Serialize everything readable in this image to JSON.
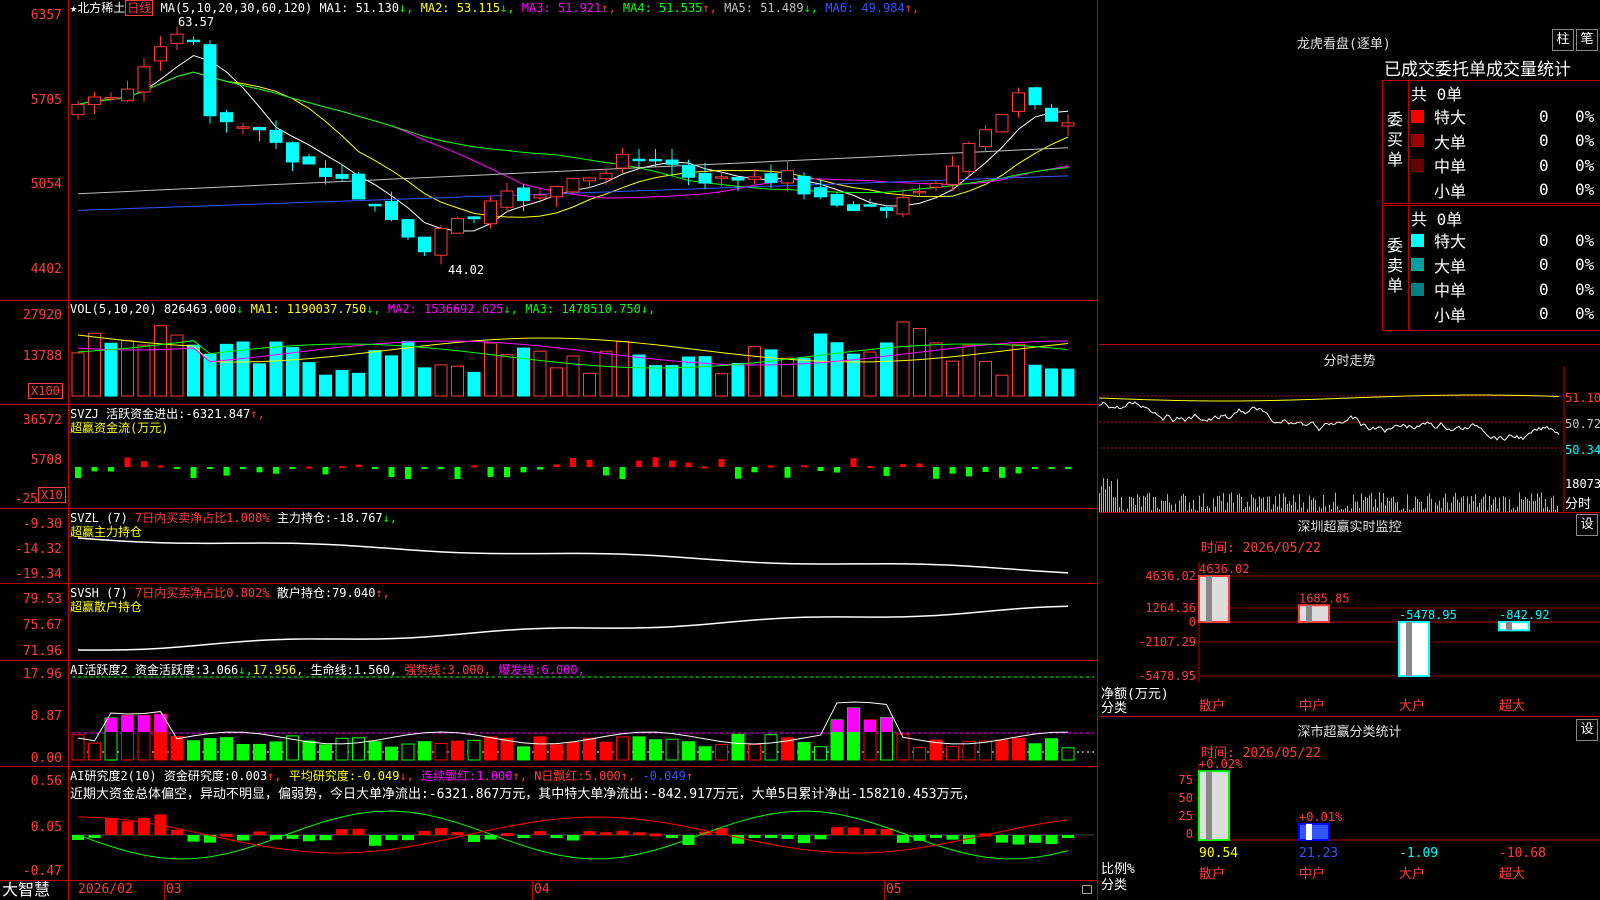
{
  "kline": {
    "star": "★",
    "stock_name": "北方稀土",
    "period": "日线",
    "ma_label": "MA(5,10,20,30,60,120)",
    "ma": [
      {
        "label": "MA1:",
        "value": "51.130",
        "arrow": "↓",
        "color": "#ffffff"
      },
      {
        "label": "MA2:",
        "value": "53.115",
        "arrow": "↓",
        "color": "#ffff00"
      },
      {
        "label": "MA3:",
        "value": "51.921",
        "arrow": "↑",
        "color": "#ff00ff"
      },
      {
        "label": "MA4:",
        "value": "51.535",
        "arrow": "↑",
        "color": "#00ff00"
      },
      {
        "label": "MA5:",
        "value": "51.489",
        "arrow": "↓",
        "color": "#c0c0c0"
      },
      {
        "label": "MA6:",
        "value": "49.984",
        "arrow": "↑",
        "color": "#3355ff"
      }
    ],
    "yaxis": [
      "6357",
      "5705",
      "5054",
      "4402"
    ],
    "high_mark": "63.57",
    "low_mark": "44.02"
  },
  "vol": {
    "label": "VOL(5,10,20)",
    "value": "826463.000",
    "value_arrow": "↓",
    "ma": [
      {
        "label": "MA1:",
        "value": "1190037.750",
        "arrow": "↓",
        "color": "#ffff00"
      },
      {
        "label": "MA2:",
        "value": "1536692.625",
        "arrow": "↓",
        "color": "#ff00ff"
      },
      {
        "label": "MA3:",
        "value": "1478510.750",
        "arrow": "↓",
        "color": "#00ff00"
      }
    ],
    "yaxis": [
      "27920",
      "13788"
    ],
    "unit": "X100"
  },
  "svzj": {
    "label": "SVZJ",
    "item": "活跃资金进出:",
    "value": "-6321.847",
    "arrow": "↑,",
    "subtitle": "超赢资金流(万元)",
    "yaxis": [
      "36572",
      "5708",
      "-25"
    ],
    "unit": "X10"
  },
  "svzl": {
    "label": "SVZL (7)",
    "item1": "7日内买卖净占比1.008%",
    "item2": "主力持仓:",
    "value": "-18.767",
    "arrow": "↓,",
    "subtitle": "超赢主力持仓",
    "yaxis": [
      "-9.30",
      "-14.32",
      "-19.34"
    ]
  },
  "svsh": {
    "label": "SVSH (7)",
    "item1": "7日内买卖净占比0.802%",
    "item2": "散户持仓:",
    "value": "79.040",
    "arrow": "↑,",
    "subtitle": "超赢散户持仓",
    "yaxis": [
      "79.53",
      "75.67",
      "71.96"
    ]
  },
  "ai1": {
    "label": "AI活跃度2",
    "item": "资金活跃度:",
    "value": "3.066",
    "arrow": "↓,",
    "v2": "17.956",
    "item3": "生命线:",
    "v3": "1.560,",
    "item4": "强势线:",
    "v4": "3.000,",
    "item5": "爆发线:",
    "v5": "6.000,",
    "yaxis": [
      "17.96",
      "8.87",
      "0.00"
    ]
  },
  "ai2": {
    "label": "AI研究度2(10)",
    "item": "资金研究度:",
    "value": "0.003",
    "arrow": "↑,",
    "item2": "平均研究度:",
    "v2": "-0.049",
    "item3": "连续飘红:",
    "v3": "1.000",
    "item4": "N日飘红:",
    "v4": "5.000",
    "v5": "-0.049",
    "comment": "近期大资金总体偏空，异动不明显，偏弱势，今日大单净流出:-6321.867万元，其中特大单净流出:-842.917万元，大单5日累计净出-158210.453万元，",
    "yaxis": [
      "0.56",
      "0.05",
      "-0.47"
    ]
  },
  "timeaxis": {
    "brand": "大智慧",
    "labels": [
      "2026/02",
      "03",
      "04",
      "05"
    ]
  },
  "right": {
    "longhu_title": "龙虎看盘(逐单)",
    "btn_zhu": "柱",
    "btn_bi": "笔",
    "order_header": "已成交委托单成交量统计",
    "buy_label": "委买单",
    "sell_label": "委卖单",
    "buy_total": "共 0单",
    "sell_total": "共 0单",
    "buy_rows": [
      {
        "name": "特大",
        "count": "0",
        "pct": "0%",
        "color": "#ff0000"
      },
      {
        "name": "大单",
        "count": "0",
        "pct": "0%",
        "color": "#990000"
      },
      {
        "name": "中单",
        "count": "0",
        "pct": "0%",
        "color": "#660000"
      },
      {
        "name": "小单",
        "count": "0",
        "pct": "0%",
        "color": "#000000"
      }
    ],
    "sell_rows": [
      {
        "name": "特大",
        "count": "0",
        "pct": "0%",
        "color": "#00ffff"
      },
      {
        "name": "大单",
        "count": "0",
        "pct": "0%",
        "color": "#00a0a0"
      },
      {
        "name": "中单",
        "count": "0",
        "pct": "0%",
        "color": "#008080"
      },
      {
        "name": "小单",
        "count": "0",
        "pct": "0%",
        "color": "#000000"
      }
    ],
    "intraday_title": "分时走势",
    "intraday_yaxis": [
      "51.10",
      "50.72",
      "50.34"
    ],
    "intraday_vol": "18073",
    "intraday_tag": "分时",
    "monitor": {
      "title": "深圳超赢实时监控",
      "btn": "设",
      "time": "时间: 2026/05/22",
      "yaxis": [
        "4636.02",
        "1264.36",
        "0",
        "-2107.29",
        "-5478.95"
      ],
      "ylabel": "净额(万元)",
      "xlabel": "分类",
      "categories": [
        "散户",
        "中户",
        "大户",
        "超大"
      ],
      "values": [
        "4636.02",
        "1685.85",
        "-5478.95",
        "-842.92"
      ]
    },
    "classify": {
      "title": "深市超赢分类统计",
      "btn": "设",
      "time": "时间: 2026/05/22",
      "yaxis": [
        "75",
        "50",
        "25",
        "0"
      ],
      "ylabel": "比例%",
      "xlabel": "分类",
      "top_labels": [
        "+0.02%",
        "+0.01%"
      ],
      "categories": [
        "散户",
        "中户",
        "大户",
        "超大"
      ],
      "values": [
        "90.54",
        "21.23",
        "-1.09",
        "-10.68"
      ]
    }
  }
}
